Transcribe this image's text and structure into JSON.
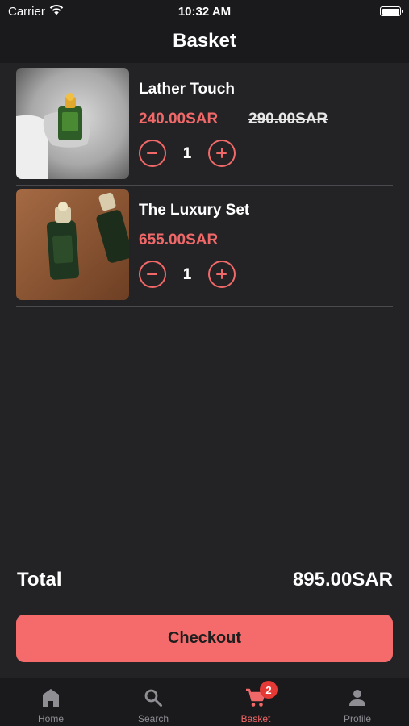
{
  "status_bar": {
    "carrier": "Carrier",
    "time": "10:32 AM"
  },
  "header": {
    "title": "Basket"
  },
  "items": [
    {
      "name": "Lather Touch",
      "price": "240.00SAR",
      "old_price": "290.00SAR",
      "quantity": "1"
    },
    {
      "name": "The Luxury Set",
      "price": "655.00SAR",
      "quantity": "1"
    }
  ],
  "summary": {
    "total_label": "Total",
    "total_value": "895.00SAR"
  },
  "checkout": {
    "label": "Checkout"
  },
  "tabs": {
    "home": {
      "label": "Home",
      "icon": "home-icon"
    },
    "search": {
      "label": "Search",
      "icon": "search-icon"
    },
    "basket": {
      "label": "Basket",
      "icon": "cart-icon",
      "badge": "2"
    },
    "profile": {
      "label": "Profile",
      "icon": "person-icon"
    }
  },
  "colors": {
    "accent": "#f06868",
    "background": "#232326",
    "bar": "#1a1a1d",
    "badge": "#e53935"
  }
}
